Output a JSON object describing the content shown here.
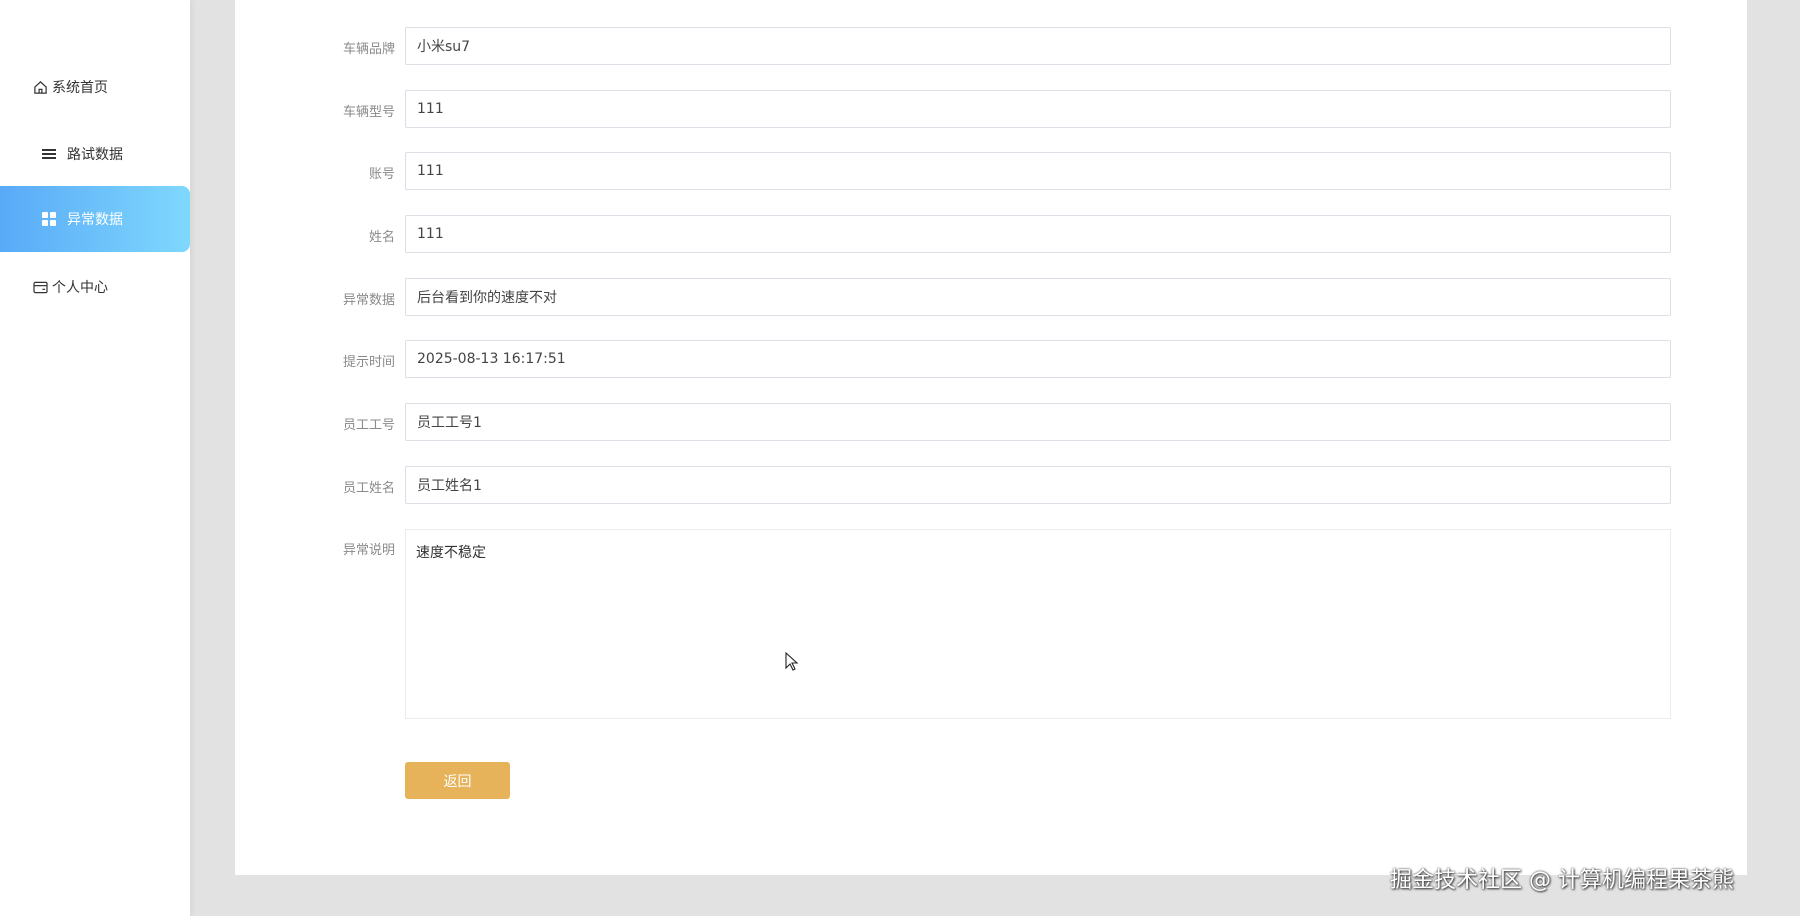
{
  "sidebar": {
    "items": [
      {
        "label": "系统首页",
        "icon": "home-icon"
      },
      {
        "label": "路试数据",
        "icon": "list-icon"
      },
      {
        "label": "异常数据",
        "icon": "grid-icon",
        "active": true
      },
      {
        "label": "个人中心",
        "icon": "card-icon"
      }
    ],
    "active_colors": [
      "#58aaf7",
      "#7fd8fd"
    ]
  },
  "form": {
    "fields": [
      {
        "label": "车辆品牌",
        "value": "小米su7"
      },
      {
        "label": "车辆型号",
        "value": "111"
      },
      {
        "label": "账号",
        "value": "111"
      },
      {
        "label": "姓名",
        "value": "111"
      },
      {
        "label": "异常数据",
        "value": "后台看到你的速度不对"
      },
      {
        "label": "提示时间",
        "value": "2025-08-13 16:17:51"
      },
      {
        "label": "员工工号",
        "value": "员工工号1"
      },
      {
        "label": "员工姓名",
        "value": "员工姓名1"
      }
    ],
    "description": {
      "label": "异常说明",
      "value": "速度不稳定"
    },
    "back_button": "返回",
    "button_color": "#e6b35a"
  },
  "watermark": "掘金技术社区 @ 计算机编程果茶熊"
}
